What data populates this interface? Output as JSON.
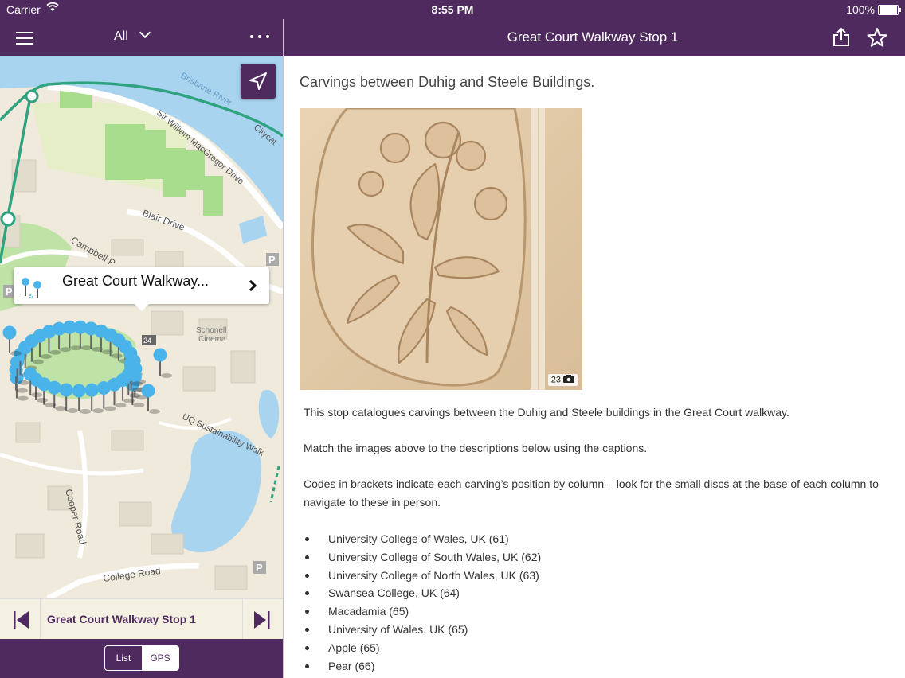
{
  "status_bar": {
    "carrier": "Carrier",
    "time": "8:55 PM",
    "battery": "100%"
  },
  "left_panel": {
    "filter_label": "All",
    "map": {
      "labels": {
        "river": "Brisbane River",
        "drive": "Sir William MacGregor Drive",
        "citycat": "Citycat",
        "blair": "Blair Drive",
        "campbell": "Campbell P",
        "cinema": "Schonell\nCinema",
        "cinema_line1": "Schonell",
        "cinema_line2": "Cinema",
        "sustain": "UQ Sustainability Walk",
        "cooper": "Cooper Road",
        "college": "College Road",
        "parking": "P",
        "pin_count": "24"
      },
      "callout_title": "Great Court Walkway..."
    },
    "stop_bar": {
      "label": "Great Court Walkway Stop 1"
    },
    "segment": {
      "list": "List",
      "gps": "GPS",
      "selected": "GPS"
    }
  },
  "detail": {
    "nav_title": "Great Court Walkway Stop 1",
    "heading": "Carvings between Duhig and Steele Buildings.",
    "photo_count": "23",
    "paragraphs": [
      "This stop catalogues carvings between the Duhig and Steele buildings in the Great Court walkway.",
      "Match the images above to the descriptions below using the captions.",
      "Codes in brackets indicate each carving’s position by column – look for the small discs at the base of each column to navigate to these in person."
    ],
    "items": [
      "University College of Wales, UK (61)",
      "University College of South Wales, UK (62)",
      "University College of North Wales, UK (63)",
      "Swansea College, UK (64)",
      "Macadamia (65)",
      "University of Wales, UK (65)",
      "Apple (65)",
      "Pear (66)"
    ]
  },
  "colors": {
    "brand": "#4f2a5f",
    "water": "#a8d4f0",
    "route": "#2fa37f",
    "pin": "#4ab3ea"
  }
}
